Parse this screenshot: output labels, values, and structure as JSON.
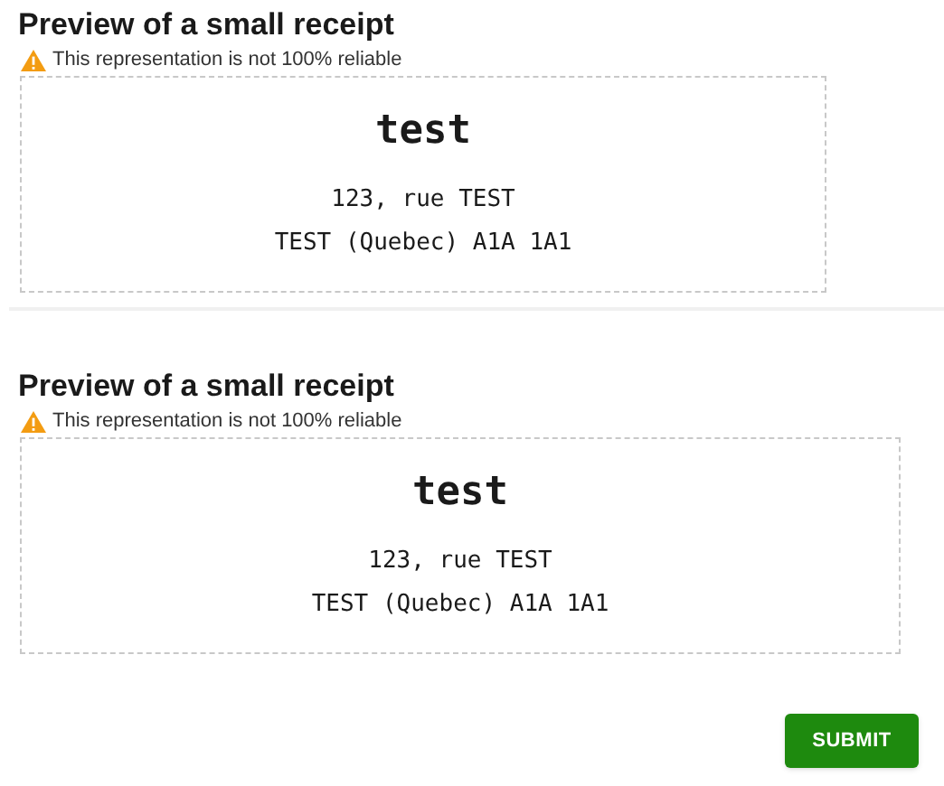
{
  "previews": [
    {
      "title": "Preview of a small receipt",
      "warning": "This representation is not 100% reliable",
      "receipt": {
        "name": "test",
        "lines": [
          "123, rue TEST",
          "TEST (Quebec) A1A 1A1"
        ]
      }
    },
    {
      "title": "Preview of a small receipt",
      "warning": "This representation is not 100% reliable",
      "receipt": {
        "name": "test",
        "lines": [
          "123, rue TEST",
          "TEST (Quebec) A1A 1A1"
        ]
      }
    }
  ],
  "submit_button": "SUBMIT"
}
